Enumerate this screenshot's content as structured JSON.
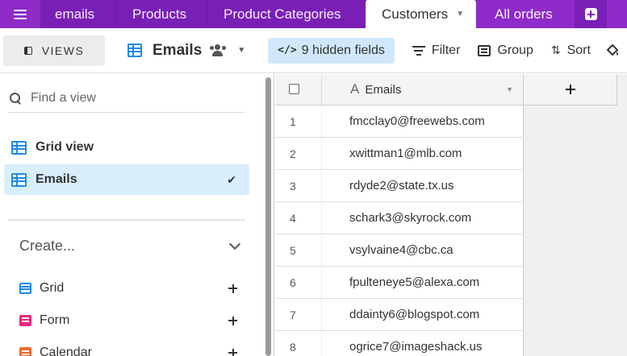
{
  "topbar": {
    "tabs": [
      {
        "label": "emails"
      },
      {
        "label": "Products"
      },
      {
        "label": "Product Categories"
      },
      {
        "label": "Customers"
      },
      {
        "label": "All orders"
      }
    ],
    "colors": {
      "bar": "#8e2bc9",
      "active_tab": "#ffffff"
    }
  },
  "toolbar": {
    "views_label": "VIEWS",
    "current_view": "Emails",
    "hidden_fields_label": "9 hidden fields",
    "filter_label": "Filter",
    "group_label": "Group",
    "sort_label": "Sort"
  },
  "sidebar": {
    "search_placeholder": "Find a view",
    "views": [
      {
        "label": "Grid view",
        "icon": "grid-icon"
      },
      {
        "label": "Emails",
        "icon": "grid-icon",
        "selected": true
      }
    ],
    "create_label": "Create...",
    "create_items": [
      {
        "label": "Grid",
        "icon": "grid-icon"
      },
      {
        "label": "Form",
        "icon": "form-icon"
      },
      {
        "label": "Calendar",
        "icon": "calendar-icon"
      }
    ]
  },
  "grid": {
    "column_header": "Emails",
    "column_type_icon": "A",
    "rows": [
      {
        "num": "1",
        "email": "fmcclay0@freewebs.com"
      },
      {
        "num": "2",
        "email": "xwittman1@mlb.com"
      },
      {
        "num": "3",
        "email": "rdyde2@state.tx.us"
      },
      {
        "num": "4",
        "email": "schark3@skyrock.com"
      },
      {
        "num": "5",
        "email": "vsylvaine4@cbc.ca"
      },
      {
        "num": "6",
        "email": "fpulteneye5@alexa.com"
      },
      {
        "num": "7",
        "email": "ddainty6@blogspot.com"
      },
      {
        "num": "8",
        "email": "ogrice7@imageshack.us"
      }
    ]
  }
}
